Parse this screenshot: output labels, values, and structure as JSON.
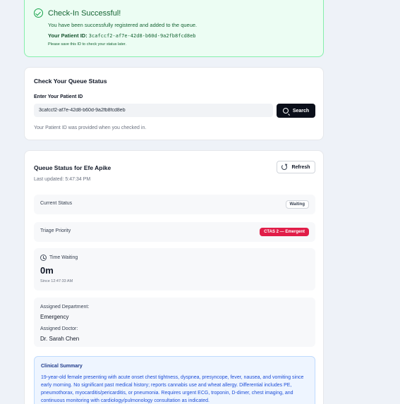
{
  "success": {
    "title": "Check-In Successful!",
    "message": "You have been successfully registered and added to the queue.",
    "patient_id_label": "Your Patient ID:",
    "patient_id": "3cafccf2-af7e-42d8-b60d-9a2fb8fcd8eb",
    "note": "Please save this ID to check your status later."
  },
  "check": {
    "heading": "Check Your Queue Status",
    "label": "Enter Your Patient ID",
    "input_value": "3cafccf2-af7e-42d8-b60d-9a2fb8fcd8eb",
    "search_label": "Search",
    "hint": "Your Patient ID was provided when you checked in."
  },
  "queue": {
    "heading": "Queue Status for Efe Apike",
    "last_updated": "Last updated: 5:47:34 PM",
    "refresh_label": "Refresh",
    "current_status_label": "Current Status",
    "current_status_value": "Waiting",
    "triage_label": "Triage Priority",
    "triage_value": "CTAS 2 — Emergent",
    "time_waiting_label": "Time Waiting",
    "time_waiting_value": "0m",
    "since": "Since 12:47:33 AM",
    "department_label": "Assigned Department:",
    "department_value": "Emergency",
    "doctor_label": "Assigned Doctor:",
    "doctor_value": "Dr. Sarah Chen",
    "summary_label": "Clinical Summary",
    "summary_text": "19-year-old female presenting with acute onset chest tightness, dyspnea, presyncope, fever, nausea, and vomiting since early morning. No significant past medical history; reports cannabis use and wheat allergy. Differential includes PE, pneumothorax, myocarditis/pericarditis, or pneumonia. Requires urgent ECG, troponin, D-dimer, chest imaging, and continuous monitoring with cardiology/pulmonology consultation as indicated."
  },
  "colors": {
    "success_bg": "#ecfdf3",
    "success_text": "#166534",
    "primary_button": "#0b0f1a",
    "ctas_badge": "#e11d48",
    "summary_bg": "#eef5ff",
    "summary_text": "#1d4ed8"
  }
}
